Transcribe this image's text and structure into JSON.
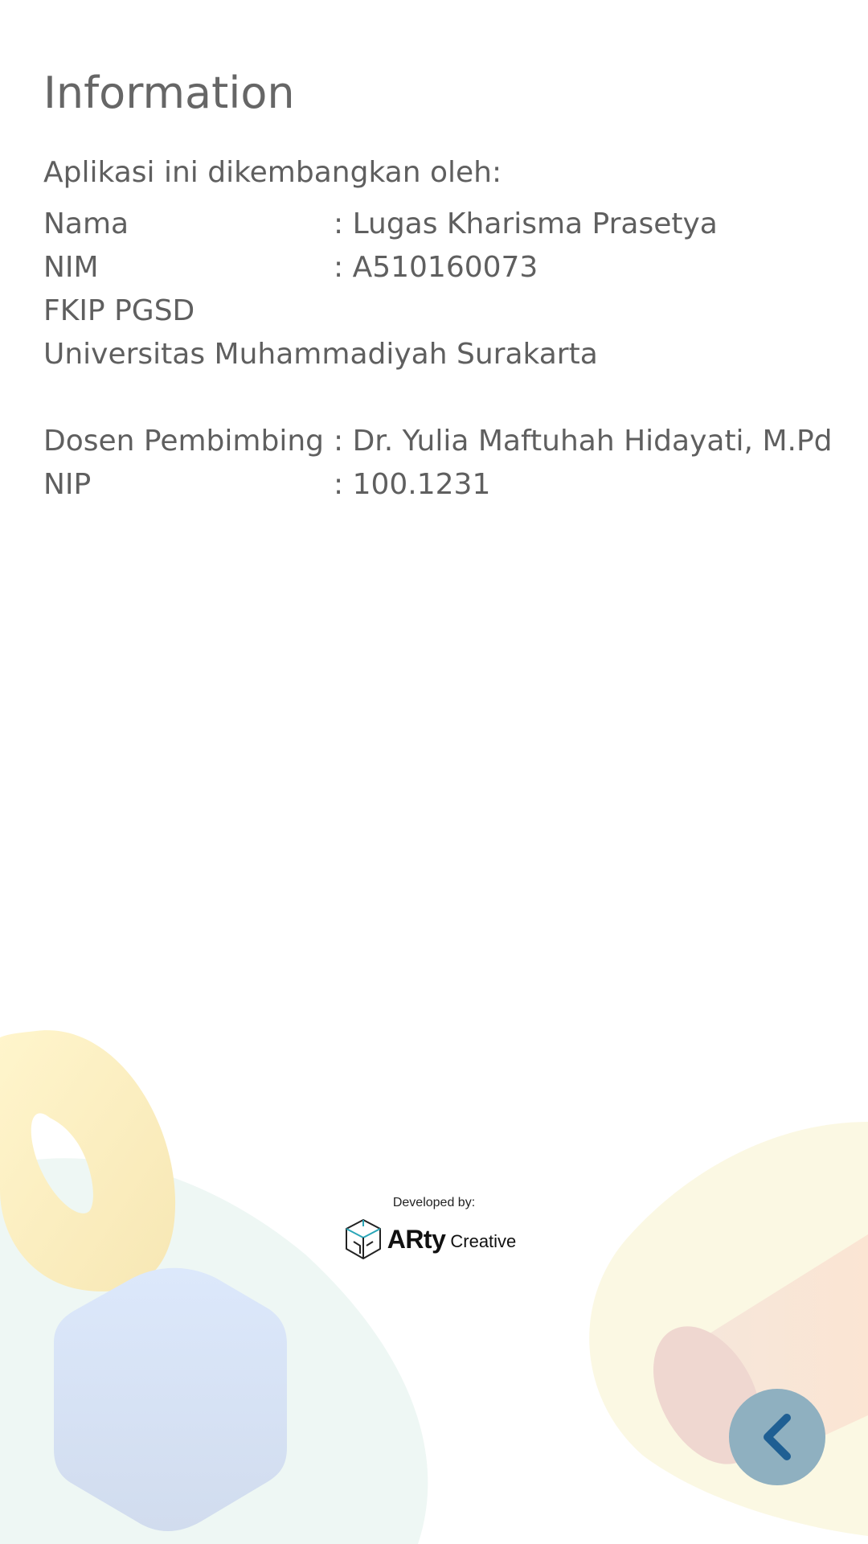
{
  "page": {
    "title": "Information",
    "intro": "Aplikasi ini dikembangkan oleh:"
  },
  "developer": {
    "name_label": "Nama",
    "name_value": ": Lugas Kharisma Prasetya",
    "nim_label": "NIM",
    "nim_value": ": A510160073",
    "faculty": "FKIP PGSD",
    "university": "Universitas Muhammadiyah Surakarta"
  },
  "supervisor": {
    "label": "Dosen Pembimbing",
    "value": ": Dr. Yulia Maftuhah Hidayati, M.Pd",
    "nip_label": "NIP",
    "nip_value": ": 100.1231"
  },
  "credits": {
    "label": "Developed by:",
    "brand_name": "ARty",
    "brand_sub": "Creative"
  },
  "icons": {
    "brand_logo": "cube-logo-icon",
    "back": "chevron-left-icon"
  },
  "colors": {
    "text": "#5f5f5f",
    "back_button_bg": "#8fb0c0",
    "back_chevron": "#1f5f93",
    "logo_accent": "#2aa6b8"
  }
}
